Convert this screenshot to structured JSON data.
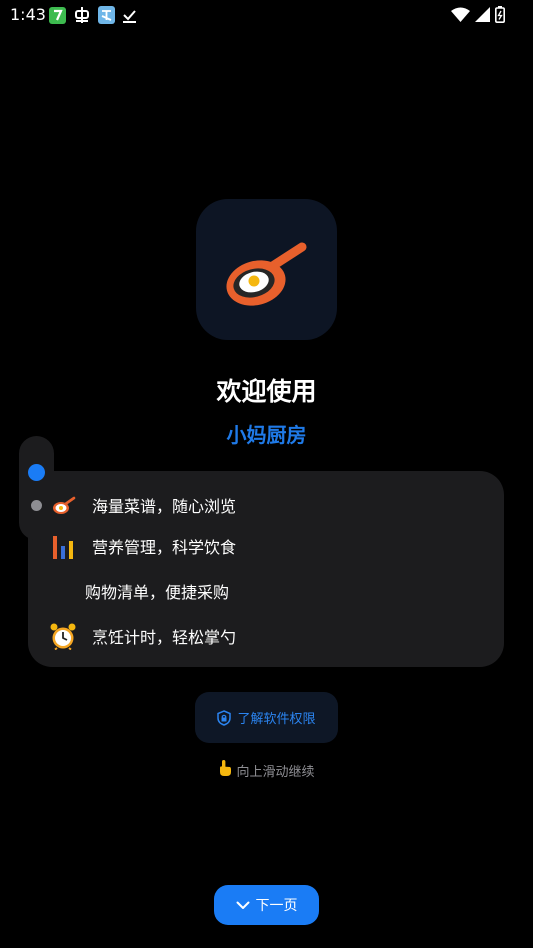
{
  "status_bar": {
    "time": "1:43",
    "left_icons": [
      "app-7-icon",
      "bug-icon",
      "app-shield-icon",
      "download-complete-icon"
    ],
    "right_icons": [
      "wifi-icon",
      "cell-signal-icon",
      "battery-icon"
    ]
  },
  "welcome": {
    "title": "欢迎使用",
    "app_name": "小妈厨房"
  },
  "pager": {
    "page_count": 2,
    "current_page": 1
  },
  "features": [
    {
      "icon": "frying-pan-icon",
      "label": "海量菜谱，随心浏览"
    },
    {
      "icon": "bar-chart-icon",
      "label": "营养管理，科学饮食"
    },
    {
      "icon": "shopping-cart-icon",
      "label": "购物清单，便捷采购"
    },
    {
      "icon": "alarm-clock-icon",
      "label": "烹饪计时，轻松掌勺"
    }
  ],
  "permissions_button": {
    "icon": "shield-lock-icon",
    "label": "了解软件权限"
  },
  "swipe_hint": {
    "icon": "pointing-up-icon",
    "text": "向上滑动继续"
  },
  "next_button": {
    "icon": "chevron-down-icon",
    "label": "下一页"
  },
  "colors": {
    "background": "#000000",
    "accent": "#1a7cf5",
    "card": "#1c1c1e",
    "pan_orange": "#e8602c"
  }
}
